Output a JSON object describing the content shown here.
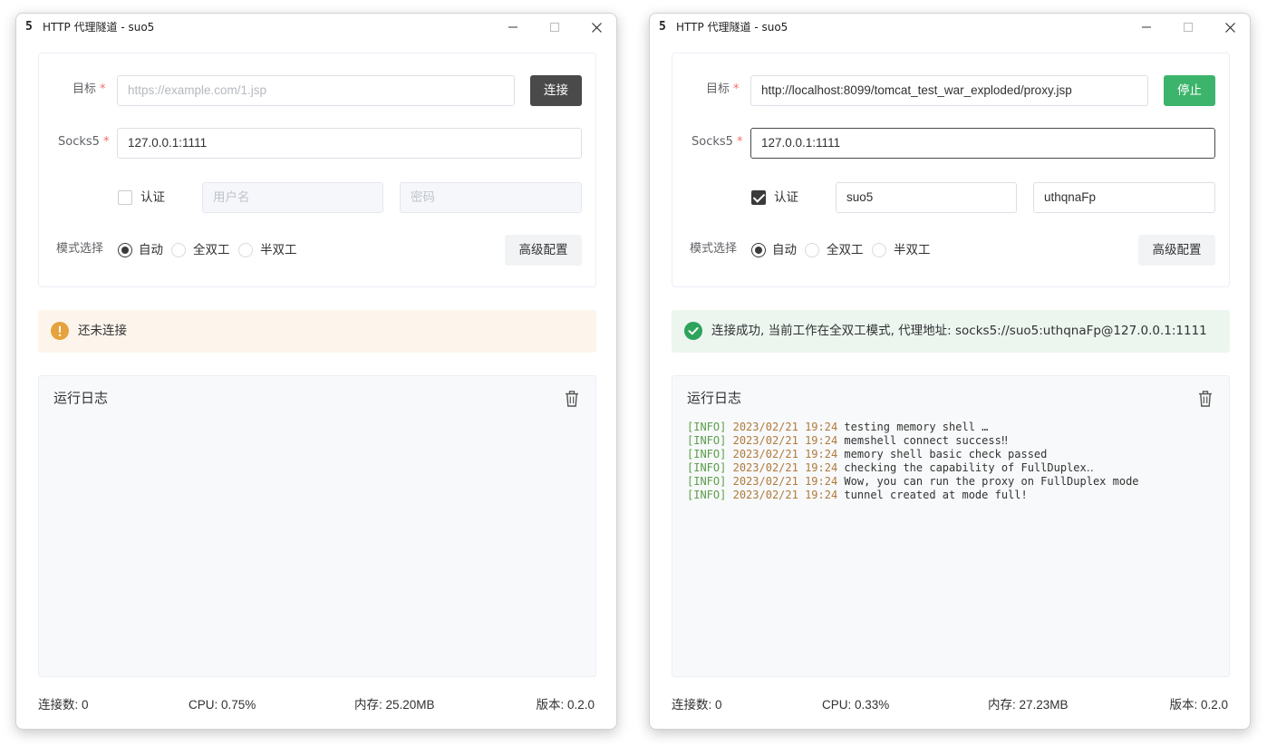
{
  "windows": [
    {
      "app_icon": "5",
      "title": "HTTP 代理隧道 - suo5",
      "form": {
        "target_label": "目标",
        "target_value": "",
        "target_placeholder": "https://example.com/1.jsp",
        "action_button": "连接",
        "socks_label": "Socks5",
        "socks_value": "127.0.0.1:1111",
        "auth_label": "认证",
        "auth_checked": false,
        "username_value": "",
        "username_placeholder": "用户名",
        "password_value": "",
        "password_placeholder": "密码",
        "mode_label": "模式选择",
        "modes": [
          "自动",
          "全双工",
          "半双工"
        ],
        "selected_mode": 0,
        "advanced_button": "高级配置"
      },
      "alert": {
        "type": "warning",
        "text": "还未连接"
      },
      "log": {
        "title": "运行日志",
        "lines": []
      },
      "status": {
        "connections": "连接数: 0",
        "cpu": "CPU: 0.75%",
        "memory": "内存: 25.20MB",
        "version": "版本: 0.2.0"
      }
    },
    {
      "app_icon": "5",
      "title": "HTTP 代理隧道 - suo5",
      "form": {
        "target_label": "目标",
        "target_value": "http://localhost:8099/tomcat_test_war_exploded/proxy.jsp",
        "target_placeholder": "",
        "action_button": "停止",
        "socks_label": "Socks5",
        "socks_value": "127.0.0.1:1111",
        "auth_label": "认证",
        "auth_checked": true,
        "username_value": "suo5",
        "username_placeholder": "",
        "password_value": "uthqnaFp",
        "password_placeholder": "",
        "mode_label": "模式选择",
        "modes": [
          "自动",
          "全双工",
          "半双工"
        ],
        "selected_mode": 0,
        "advanced_button": "高级配置"
      },
      "alert": {
        "type": "success",
        "text": "连接成功, 当前工作在全双工模式, 代理地址: socks5://suo5:uthqnaFp@127.0.0.1:1111"
      },
      "log": {
        "title": "运行日志",
        "lines": [
          {
            "level": "[INFO]",
            "time": "2023/02/21 19:24",
            "message": "testing memory shell …"
          },
          {
            "level": "[INFO]",
            "time": "2023/02/21 19:24",
            "message": "memshell connect success‼"
          },
          {
            "level": "[INFO]",
            "time": "2023/02/21 19:24",
            "message": "memory shell basic check passed"
          },
          {
            "level": "[INFO]",
            "time": "2023/02/21 19:24",
            "message": "checking the capability of FullDuplex‥"
          },
          {
            "level": "[INFO]",
            "time": "2023/02/21 19:24",
            "message": "Wow, you can run the proxy on FullDuplex mode"
          },
          {
            "level": "[INFO]",
            "time": "2023/02/21 19:24",
            "message": "tunnel created at mode full!"
          }
        ]
      },
      "status": {
        "connections": "连接数: 0",
        "cpu": "CPU: 0.33%",
        "memory": "内存: 27.23MB",
        "version": "版本: 0.2.0"
      }
    }
  ],
  "colors": {
    "connect_button": "#4a4a4a",
    "stop_button": "#3cb46b",
    "warning_bg": "#fdf5ec",
    "warning_icon": "#e6a23c",
    "success_bg": "#ecf6ef",
    "success_icon": "#2ea35b",
    "required_mark": "#f56c6c"
  },
  "icons": {
    "app": "suo5-logo-icon",
    "minimize": "minimize-icon",
    "maximize": "maximize-icon",
    "close": "close-icon",
    "warning": "warning-circle-icon",
    "success": "check-circle-icon",
    "clear_log": "trash-icon"
  }
}
